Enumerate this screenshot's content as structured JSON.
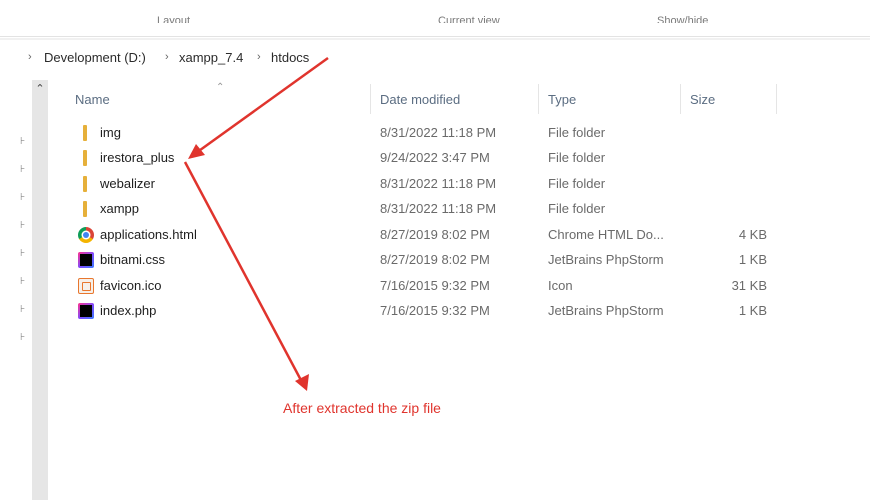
{
  "ribbon": {
    "groups": [
      "Layout",
      "Current view",
      "Show/hide"
    ]
  },
  "breadcrumb": [
    "Development (D:)",
    "xampp_7.4",
    "htdocs"
  ],
  "columns": {
    "name": "Name",
    "date": "Date modified",
    "type": "Type",
    "size": "Size"
  },
  "files": [
    {
      "name": "img",
      "date": "8/31/2022 11:18 PM",
      "type": "File folder",
      "size": "",
      "icon": "folder-icon"
    },
    {
      "name": "irestora_plus",
      "date": "9/24/2022 3:47 PM",
      "type": "File folder",
      "size": "",
      "icon": "folder-icon"
    },
    {
      "name": "webalizer",
      "date": "8/31/2022 11:18 PM",
      "type": "File folder",
      "size": "",
      "icon": "folder-icon"
    },
    {
      "name": "xampp",
      "date": "8/31/2022 11:18 PM",
      "type": "File folder",
      "size": "",
      "icon": "folder-icon"
    },
    {
      "name": "applications.html",
      "date": "8/27/2019 8:02 PM",
      "type": "Chrome HTML Do...",
      "size": "4 KB",
      "icon": "chrome-icon"
    },
    {
      "name": "bitnami.css",
      "date": "8/27/2019 8:02 PM",
      "type": "JetBrains PhpStorm",
      "size": "1 KB",
      "icon": "phpstorm-icon"
    },
    {
      "name": "favicon.ico",
      "date": "7/16/2015 9:32 PM",
      "type": "Icon",
      "size": "31 KB",
      "icon": "ico-file-icon"
    },
    {
      "name": "index.php",
      "date": "7/16/2015 9:32 PM",
      "type": "JetBrains PhpStorm",
      "size": "1 KB",
      "icon": "phpstorm-icon"
    }
  ],
  "annotation": "After extracted the zip file",
  "colors": {
    "arrow": "#e0342d",
    "folder": "#e6b03a",
    "scrollbar": "#e6e6e6"
  }
}
